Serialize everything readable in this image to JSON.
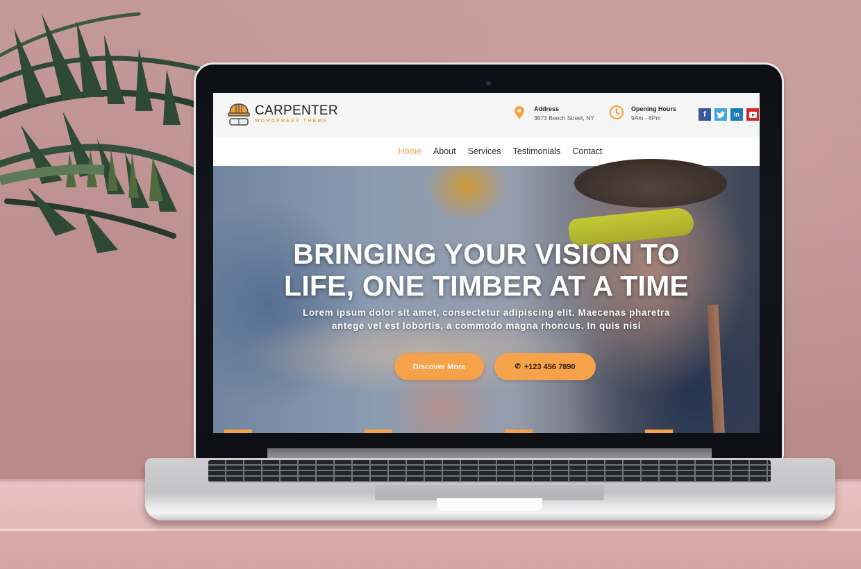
{
  "brand": {
    "name": "CARPENTER",
    "tagline": "WORDPRESS THEME",
    "accent_color": "#f6a24a"
  },
  "header": {
    "address": {
      "icon": "map-pin-icon",
      "title": "Address",
      "value": "3673 Beech Street, NY"
    },
    "hours": {
      "icon": "clock-icon",
      "title": "Opening Hours",
      "value": "9Am - 6Pm"
    },
    "social": [
      {
        "name": "facebook",
        "glyph": "f",
        "color": "#3b5998"
      },
      {
        "name": "twitter",
        "glyph": "🐦",
        "color": "#3fa8dc"
      },
      {
        "name": "linkedin",
        "glyph": "in",
        "color": "#1f7bb7"
      },
      {
        "name": "youtube",
        "glyph": "▶",
        "color": "#d3292b"
      }
    ]
  },
  "nav": {
    "items": [
      {
        "label": "Home",
        "active": true
      },
      {
        "label": "About",
        "active": false
      },
      {
        "label": "Services",
        "active": false
      },
      {
        "label": "Testimonials",
        "active": false
      },
      {
        "label": "Contact",
        "active": false
      }
    ]
  },
  "hero": {
    "title_line1": "BRINGING YOUR VISION TO",
    "title_line2": "LIFE, ONE TIMBER AT A TIME",
    "desc_line1": "Lorem ipsum dolor sit amet, consectetur adipiscing elit. Maecenas pharetra",
    "desc_line2": "antege vel est lobortis, a commodo magna rhoncus. In quis nisi",
    "primary_button": "Discover More",
    "phone_icon": "✆",
    "phone_button": "+123 456 7890",
    "slide_count": 4
  }
}
